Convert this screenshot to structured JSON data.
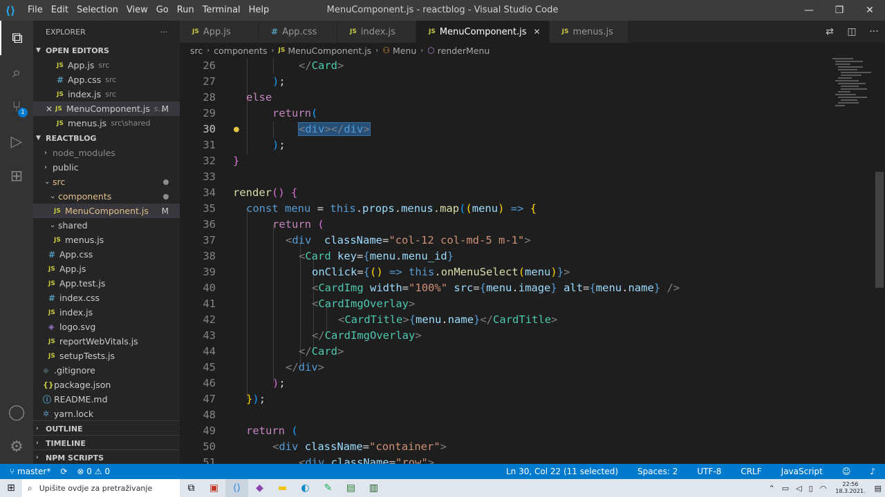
{
  "window": {
    "title": "MenuComponent.js - reactblog - Visual Studio Code",
    "menu": [
      "File",
      "Edit",
      "Selection",
      "View",
      "Go",
      "Run",
      "Terminal",
      "Help"
    ]
  },
  "activity_bar": {
    "scm_badge": "1"
  },
  "sidebar": {
    "header": "EXPLORER",
    "open_editors_title": "OPEN EDITORS",
    "open_editors": [
      {
        "icon": "JS",
        "name": "App.js",
        "path": "src"
      },
      {
        "icon": "#",
        "name": "App.css",
        "path": "src"
      },
      {
        "icon": "JS",
        "name": "index.js",
        "path": "src"
      },
      {
        "icon": "JS",
        "name": "MenuComponent.js",
        "path": "s...",
        "status": "M"
      },
      {
        "icon": "JS",
        "name": "menus.js",
        "path": "src\\shared"
      }
    ],
    "project_title": "REACTBLOG",
    "tree": [
      {
        "name": "node_modules"
      },
      {
        "name": "public"
      },
      {
        "name": "src"
      },
      {
        "name": "components"
      },
      {
        "name": "MenuComponent.js",
        "status": "M"
      },
      {
        "name": "shared"
      },
      {
        "name": "menus.js"
      },
      {
        "name": "App.css"
      },
      {
        "name": "App.js"
      },
      {
        "name": "App.test.js"
      },
      {
        "name": "index.css"
      },
      {
        "name": "index.js"
      },
      {
        "name": "logo.svg"
      },
      {
        "name": "reportWebVitals.js"
      },
      {
        "name": "setupTests.js"
      },
      {
        "name": ".gitignore"
      },
      {
        "name": "package.json"
      },
      {
        "name": "README.md"
      },
      {
        "name": "yarn.lock"
      }
    ],
    "footer": [
      "OUTLINE",
      "TIMELINE",
      "NPM SCRIPTS"
    ]
  },
  "tabs": [
    {
      "icon": "JS",
      "label": "App.js"
    },
    {
      "icon": "#",
      "label": "App.css"
    },
    {
      "icon": "JS",
      "label": "index.js"
    },
    {
      "icon": "JS",
      "label": "MenuComponent.js",
      "active": true
    },
    {
      "icon": "JS",
      "label": "menus.js"
    }
  ],
  "breadcrumb": [
    "src",
    "components",
    "MenuComponent.js",
    "Menu",
    "renderMenu"
  ],
  "editor": {
    "line_numbers": [
      "26",
      "27",
      "28",
      "29",
      "30",
      "31",
      "32",
      "33",
      "34",
      "35",
      "36",
      "37",
      "38",
      "39",
      "40",
      "41",
      "42",
      "43",
      "44",
      "45",
      "46",
      "47",
      "48",
      "49",
      "50",
      "51"
    ],
    "current_line": "30"
  },
  "status": {
    "branch": "master*",
    "errors": "0",
    "warnings": "0",
    "position": "Ln 30, Col 22 (11 selected)",
    "spaces": "Spaces: 2",
    "encoding": "UTF-8",
    "eol": "CRLF",
    "language": "JavaScript"
  },
  "taskbar": {
    "search_placeholder": "Upišite ovdje za pretraživanje",
    "time": "22:56",
    "date": "18.3.2021."
  },
  "colors": {
    "status_bar": "#007acc",
    "selection": "#264f78"
  }
}
